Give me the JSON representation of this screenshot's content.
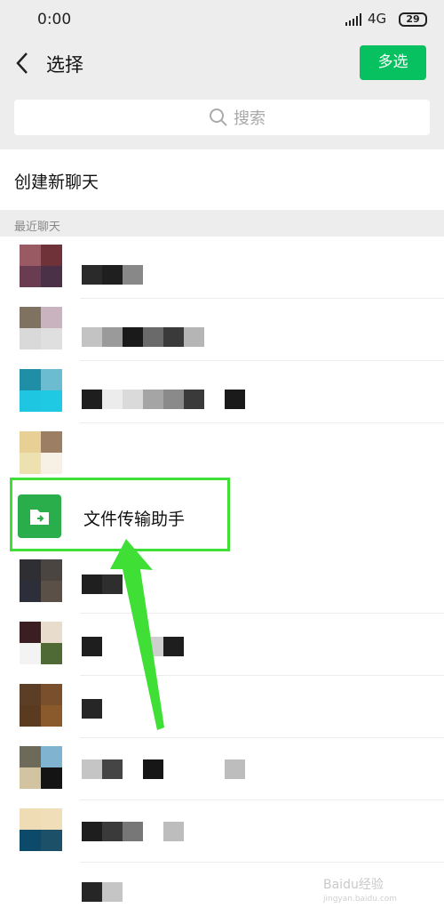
{
  "status_bar": {
    "time": "0:00",
    "network": "4G",
    "battery": "29"
  },
  "header": {
    "title": "选择",
    "multi_select_label": "多选"
  },
  "search": {
    "placeholder": "搜索"
  },
  "new_chat": {
    "label": "创建新聊天"
  },
  "recent": {
    "section_label": "最近聊天"
  },
  "highlighted_chat": {
    "name": "文件传输助手"
  },
  "watermark": {
    "brand": "Baidu经验",
    "url": "jingyan.baidu.com"
  },
  "colors": {
    "accent": "#07c160",
    "highlight_border": "#3fdf35",
    "file_icon": "#2aae4b"
  }
}
